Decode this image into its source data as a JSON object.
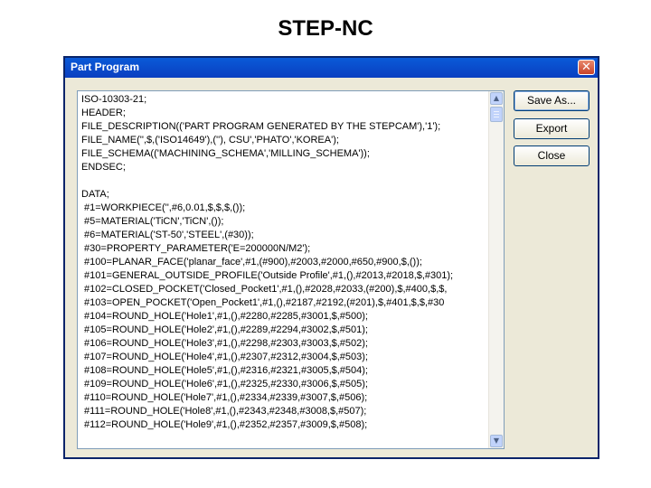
{
  "slide": {
    "title": "STEP-NC"
  },
  "window": {
    "title": "Part Program",
    "close_glyph": "✕"
  },
  "buttons": {
    "save_as": "Save As...",
    "export": "Export",
    "close": "Close"
  },
  "scrollbar": {
    "up_glyph": "▲",
    "down_glyph": "▼"
  },
  "program_lines": [
    "ISO-10303-21;",
    "HEADER;",
    "FILE_DESCRIPTION(('PART PROGRAM GENERATED BY THE STEPCAM'),'1');",
    "FILE_NAME('',$,('ISO14649'),(''), CSU','PHATO','KOREA');",
    "FILE_SCHEMA(('MACHINING_SCHEMA','MILLING_SCHEMA'));",
    "ENDSEC;",
    "",
    "DATA;",
    " #1=WORKPIECE('',#6,0.01,$,$,$,());",
    " #5=MATERIAL('TiCN','TiCN',());",
    " #6=MATERIAL('ST-50','STEEL',(#30));",
    " #30=PROPERTY_PARAMETER('E=200000N/M2');",
    " #100=PLANAR_FACE('planar_face',#1,(#900),#2003,#2000,#650,#900,$,());",
    " #101=GENERAL_OUTSIDE_PROFILE('Outside Profile',#1,(),#2013,#2018,$,#301);",
    " #102=CLOSED_POCKET('Closed_Pocket1',#1,(),#2028,#2033,(#200),$,#400,$,$,",
    " #103=OPEN_POCKET('Open_Pocket1',#1,(),#2187,#2192,(#201),$,#401,$,$,#30",
    " #104=ROUND_HOLE('Hole1',#1,(),#2280,#2285,#3001,$,#500);",
    " #105=ROUND_HOLE('Hole2',#1,(),#2289,#2294,#3002,$,#501);",
    " #106=ROUND_HOLE('Hole3',#1,(),#2298,#2303,#3003,$,#502);",
    " #107=ROUND_HOLE('Hole4',#1,(),#2307,#2312,#3004,$,#503);",
    " #108=ROUND_HOLE('Hole5',#1,(),#2316,#2321,#3005,$,#504);",
    " #109=ROUND_HOLE('Hole6',#1,(),#2325,#2330,#3006,$,#505);",
    " #110=ROUND_HOLE('Hole7',#1,(),#2334,#2339,#3007,$,#506);",
    " #111=ROUND_HOLE('Hole8',#1,(),#2343,#2348,#3008,$,#507);",
    " #112=ROUND_HOLE('Hole9',#1,(),#2352,#2357,#3009,$,#508);"
  ]
}
